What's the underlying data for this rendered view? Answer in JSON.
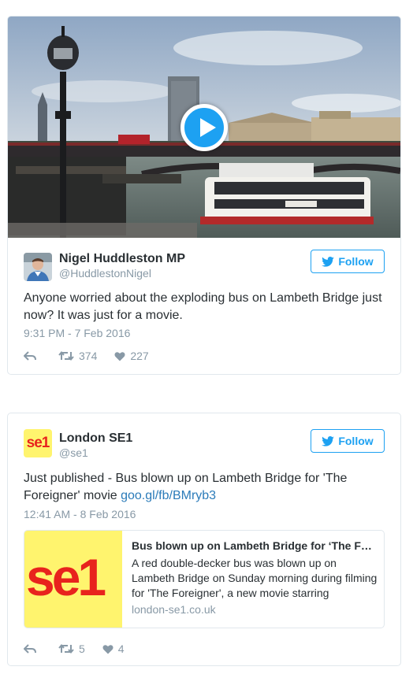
{
  "tweets": [
    {
      "name": "Nigel Huddleston MP",
      "handle": "@HuddlestonNigel",
      "follow_label": "Follow",
      "text": "Anyone worried about the exploding bus on Lambeth Bridge just now? It was just for a movie.",
      "timestamp": "9:31 PM - 7 Feb 2016",
      "retweets": "374",
      "likes": "227",
      "media": {
        "type": "video",
        "description_icon": "play-icon"
      }
    },
    {
      "name": "London SE1",
      "handle": "@se1",
      "follow_label": "Follow",
      "text": "Just published - Bus blown up on Lambeth Bridge for 'The Foreigner' movie ",
      "link_text": "goo.gl/fb/BMryb3",
      "timestamp": "12:41 AM - 8 Feb 2016",
      "retweets": "5",
      "likes": "4",
      "avatar_text": "se1",
      "card": {
        "logo_text": "se1",
        "title": "Bus blown up on Lambeth Bridge for ‘The Foreigner’ movie",
        "description": "A red double-decker bus was blown up on Lambeth Bridge on Sunday morning during filming for 'The Foreigner', a new movie starring",
        "domain": "london-se1.co.uk"
      }
    }
  ],
  "colors": {
    "accent": "#1da1f2",
    "link": "#2b7bb9",
    "muted": "#8899a6",
    "text": "#292f33",
    "se1_yellow": "#fff46e",
    "se1_red": "#e8231d"
  }
}
